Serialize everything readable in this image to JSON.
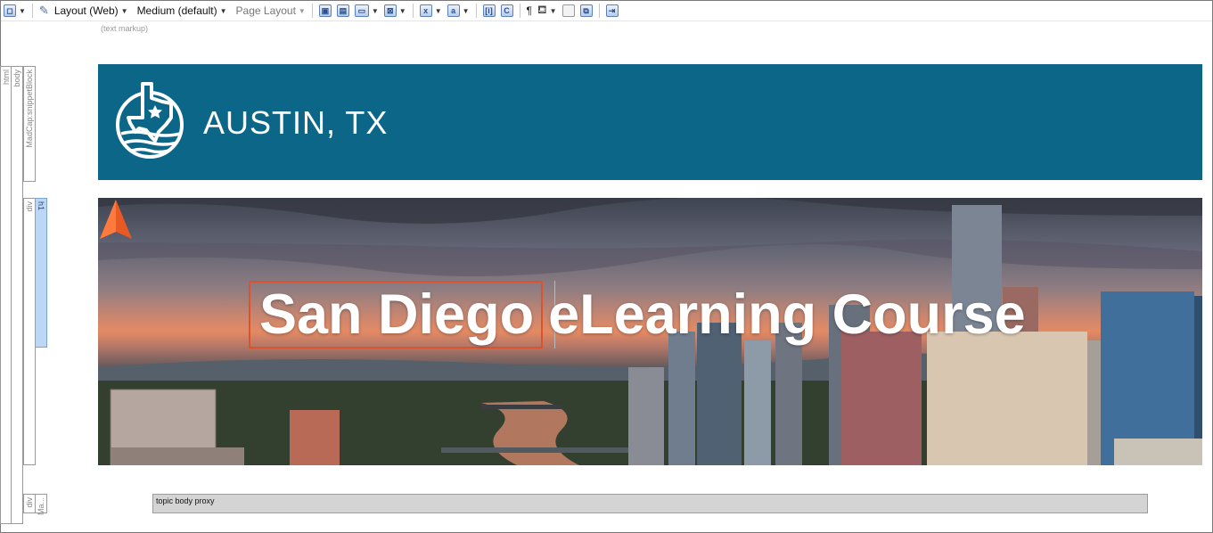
{
  "toolbar": {
    "layout_label": "Layout (Web)",
    "medium_label": "Medium (default)",
    "page_layout_label": "Page Layout"
  },
  "editor": {
    "text_markup_label": "(text markup)",
    "structure_bars": {
      "html": "html",
      "body": "body",
      "snippet": "MadCap:snippetBlock",
      "div1": "div",
      "h1": "h1",
      "div2": "div",
      "ma": "Ma..."
    }
  },
  "header": {
    "title": "AUSTIN, TX",
    "background_color": "#0b6688"
  },
  "hero": {
    "heading_selected": "San Diego",
    "heading_rest": "eLearning Course",
    "selection_color": "#d9542c"
  },
  "proxy": {
    "label": "topic body proxy"
  }
}
